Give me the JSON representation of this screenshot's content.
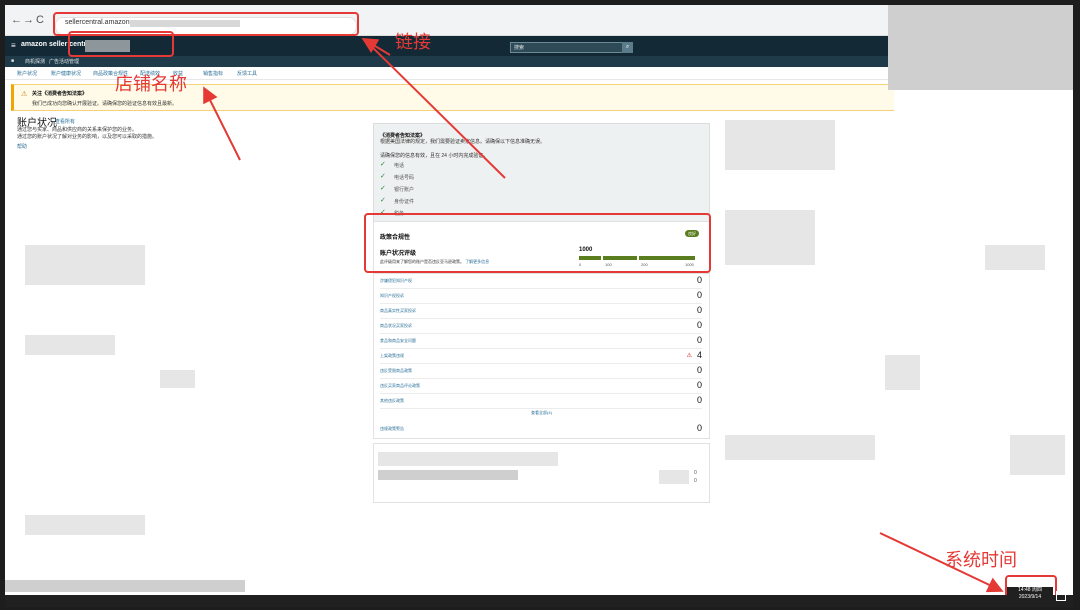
{
  "browser": {
    "url": "sellercentral.amazon.com",
    "nav_back": "←",
    "nav_forward": "→",
    "nav_reload": "C",
    "minimize": "—",
    "maximize": "▢",
    "close": "✕"
  },
  "header": {
    "logo": "amazon seller central",
    "menu_icon": "≡",
    "search_placeholder": "搜索",
    "search_icon": "🔍"
  },
  "subbar": {
    "items": [
      "■",
      "商机探测",
      "广告活动管理"
    ]
  },
  "tabs": [
    "账户状况",
    "账户健康状况",
    "商品政策合规性",
    "配送绩效",
    "收益",
    "销售指标",
    "反馈工具"
  ],
  "banner": {
    "title": "关注《消费者告知法案》",
    "text": "我们已成功向您确认开展验证。请确保您的验证信息有效且最新。"
  },
  "account": {
    "title": "账户状况",
    "link": "查看所有",
    "desc_line1": "通过您与买家、商品和供应商的关系来保护您的业务。",
    "desc_line2": "通过您的账户状况了解对业务的影响，以及您可以采取的措施。",
    "help": "帮助"
  },
  "consumer_notice": {
    "title": "《消费者告知法案》",
    "text": "根据美国法律的规定，我们需要验证卖家信息。请确保以下信息准确无误。",
    "note": "请确保您的信息有效，且在 24 小时内完成验证。",
    "checks": [
      "电话",
      "电话号码",
      "银行账户",
      "身份证件",
      "税务"
    ]
  },
  "policy": {
    "title": "政策合规性",
    "badge": "良好",
    "sub_title": "账户状况评级",
    "desc": "此评级用来了解您的账户是否违反亚马逊政策。",
    "desc_link": "了解更多信息",
    "score": "1000",
    "ticks": [
      "0",
      "100",
      "200",
      "1000"
    ]
  },
  "metrics": [
    {
      "label": "涉嫌侵犯知识产权",
      "value": "0"
    },
    {
      "label": "知识产权投诉",
      "value": "0"
    },
    {
      "label": "商品真实性买家投诉",
      "value": "0"
    },
    {
      "label": "商品状况买家投诉",
      "value": "0"
    },
    {
      "label": "食品和商品安全问题",
      "value": "0"
    },
    {
      "label": "上架政策违规",
      "value": "4",
      "warn": "⚠"
    },
    {
      "label": "违反受限商品政策",
      "value": "0"
    },
    {
      "label": "违反买家商品评论政策",
      "value": "0"
    },
    {
      "label": "其他违反政策",
      "value": "0"
    }
  ],
  "metrics_view_all": "查看全部(4)",
  "metrics_last": {
    "label": "违规政策警告",
    "value": "0"
  },
  "bottom_panel": {
    "nums": [
      "0",
      "0"
    ]
  },
  "annotations": {
    "link": "链接",
    "store_name": "店铺名称",
    "system_time": "系统时间"
  },
  "taskbar": {
    "time": "14:48 周四",
    "date": "2023/9/14"
  },
  "colors": {
    "annotation_red": "#e53935",
    "amazon_header": "#132a36",
    "good_green": "#5a7d1e"
  }
}
